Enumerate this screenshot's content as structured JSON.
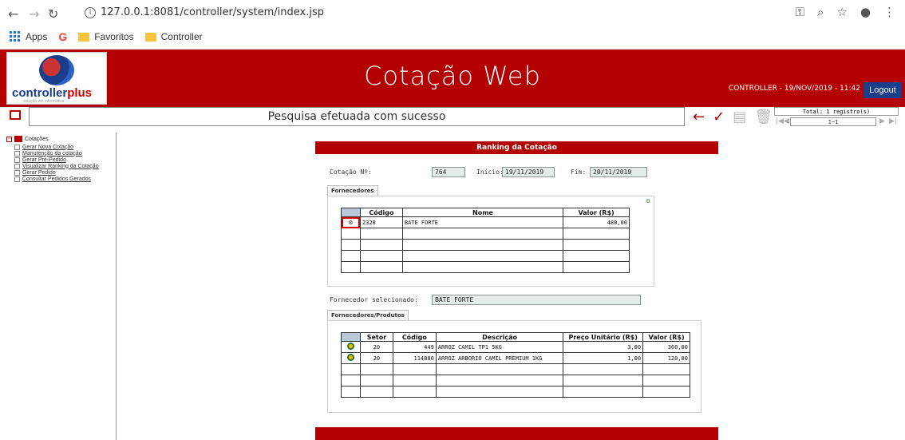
{
  "browser": {
    "url": "127.0.0.1:8081/controller/system/index.jsp",
    "bookmarks": [
      {
        "label": "Apps"
      },
      {
        "label": "Favoritos"
      },
      {
        "label": "Controller"
      }
    ]
  },
  "header": {
    "logo_text_main": "controller",
    "logo_text_accent": "plus",
    "logo_sub": "solução em informática",
    "title": "Cotação Web",
    "user_info": "CONTROLLER - 19/NOV/2019 - 11:42",
    "logout_label": "Logout"
  },
  "toolbar": {
    "message": "Pesquisa efetuada com sucesso",
    "pager_total": "Total: 1 registro(s)",
    "pager_range": "1~1"
  },
  "sidebar": {
    "root_label": "Cotações",
    "items": [
      {
        "label": "Gerar Nova Cotação"
      },
      {
        "label": "Manutenção da cotação"
      },
      {
        "label": "Gerar Pré-Pedido"
      },
      {
        "label": "Visualizar Ranking da Cotação"
      },
      {
        "label": "Gerar Pedido"
      },
      {
        "label": "Consultar Pedidos Gerados"
      }
    ]
  },
  "ranking": {
    "title": "Ranking da Cotação",
    "cotacao_label": "Cotação Nº:",
    "cotacao_value": "764",
    "inicio_label": "Início:",
    "inicio_value": "19/11/2019",
    "fim_label": "Fim:",
    "fim_value": "20/11/2019",
    "fornecedores_tab": "Fornecedores",
    "fornecedores_headers": [
      "Código",
      "Nome",
      "Valor (R$)"
    ],
    "fornecedores_rows": [
      {
        "codigo": "2328",
        "nome": "BATE FORTE",
        "valor": "480,00"
      }
    ],
    "fornecedor_sel_label": "Fornecedor selecionado:",
    "fornecedor_sel_value": "BATE FORTE",
    "produtos_tab": "Fornecedores/Produtos",
    "produtos_headers": [
      "Setor",
      "Código",
      "Descrição",
      "Preço Unitário (R$)",
      "Valor (R$)"
    ],
    "produtos_rows": [
      {
        "setor": "20",
        "codigo": "449",
        "descricao": "ARROZ CAMIL TP1 5KG",
        "preco": "3,00",
        "valor": "360,00"
      },
      {
        "setor": "20",
        "codigo": "114880",
        "descricao": "ARROZ ARBORIO CAMIL PREMIUM  1KG",
        "preco": "1,00",
        "valor": "120,00"
      }
    ]
  }
}
